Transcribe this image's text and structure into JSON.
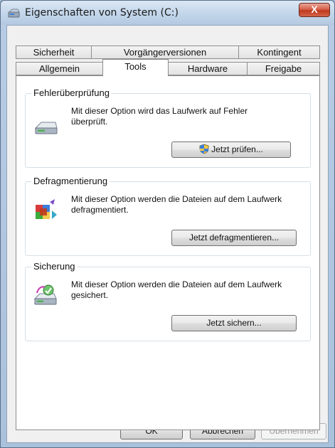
{
  "window": {
    "title": "Eigenschaften von System (C:)",
    "close_label": "X"
  },
  "tabs": {
    "row1": [
      {
        "label": "Sicherheit"
      },
      {
        "label": "Vorgängerversionen"
      },
      {
        "label": "Kontingent"
      }
    ],
    "row2": [
      {
        "label": "Allgemein"
      },
      {
        "label": "Tools",
        "selected": true
      },
      {
        "label": "Hardware"
      },
      {
        "label": "Freigabe"
      }
    ]
  },
  "groups": {
    "error_check": {
      "title": "Fehlerüberprüfung",
      "description": "Mit dieser Option wird das Laufwerk auf Fehler überprüft.",
      "button": "Jetzt prüfen...",
      "icon": "drive-icon"
    },
    "defrag": {
      "title": "Defragmentierung",
      "description": "Mit dieser Option werden die Dateien auf dem Laufwerk defragmentiert.",
      "button": "Jetzt defragmentieren...",
      "icon": "defrag-icon"
    },
    "backup": {
      "title": "Sicherung",
      "description": "Mit dieser Option werden die Dateien auf dem Laufwerk gesichert.",
      "button": "Jetzt sichern...",
      "icon": "backup-icon"
    }
  },
  "footer": {
    "ok": "OK",
    "cancel": "Abbrechen",
    "apply": "Übernehmen"
  },
  "colors": {
    "accent": "#c0391d",
    "titlebar": "#c2d5ea",
    "panel": "#ffffff"
  }
}
